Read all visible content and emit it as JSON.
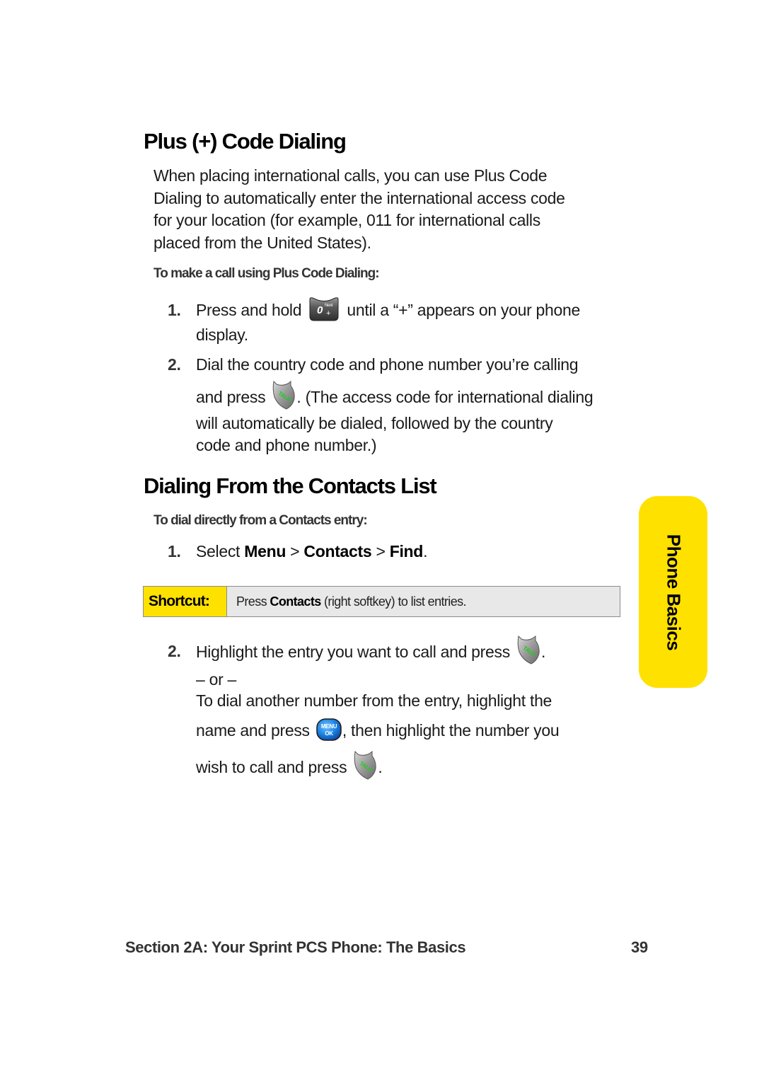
{
  "section1": {
    "heading": "Plus (+) Code Dialing",
    "intro_lines": [
      "When placing international calls, you can use Plus Code",
      "Dialing to automatically enter the international access code",
      "for your location (for example, 011 for international calls",
      "placed from the United States)."
    ],
    "subheading": "To make a call using Plus Code Dialing:",
    "steps": [
      {
        "number": "1.",
        "line1_before": "Press and hold",
        "line1_icon": "zero-next-plus-key-icon",
        "line1_after": "until a “+” appears on your phone",
        "line2": "display."
      },
      {
        "number": "2.",
        "line1": "Dial the country code and phone number you’re calling",
        "line2_before": "and press",
        "line2_icon": "talk-key-icon",
        "line2_after": ". (The access code for international dialing",
        "line3": "will automatically be dialed, followed by the country",
        "line4": "code and phone number.)"
      }
    ]
  },
  "section2": {
    "heading": "Dialing From the Contacts List",
    "subheading": "To dial directly from a Contacts entry:",
    "step1": {
      "number": "1.",
      "prefix": "Select ",
      "path": [
        "Menu",
        "Contacts",
        "Find"
      ],
      "separator": " > ",
      "suffix": "."
    },
    "shortcut": {
      "label": "Shortcut:",
      "before": "Press ",
      "keyword": "Contacts",
      "after": " (right softkey) to list entries."
    },
    "step2": {
      "number": "2.",
      "line1_before": "Highlight the entry you want to call and press",
      "line1_icon": "talk-key-icon",
      "line1_after": ".",
      "or_text": "– or –",
      "line3": "To dial another number from the entry, highlight the",
      "line4_before": "name and press",
      "line4_icon": "menu-ok-key-icon",
      "line4_after": ", then highlight the number you",
      "line5_before": "wish to call and press",
      "line5_icon": "talk-key-icon",
      "line5_after": "."
    }
  },
  "side_tab": {
    "label": "Phone Basics",
    "color": "#ffe100"
  },
  "footer": {
    "section_title": "Section 2A: Your Sprint PCS Phone: The Basics",
    "page_number": "39"
  },
  "icons": {
    "zero_key_main": "0",
    "zero_key_sup": "Next",
    "zero_key_sub": "+",
    "talk_key_label": "TALK",
    "menu_key_line1": "MENU",
    "menu_key_line2": "OK"
  }
}
